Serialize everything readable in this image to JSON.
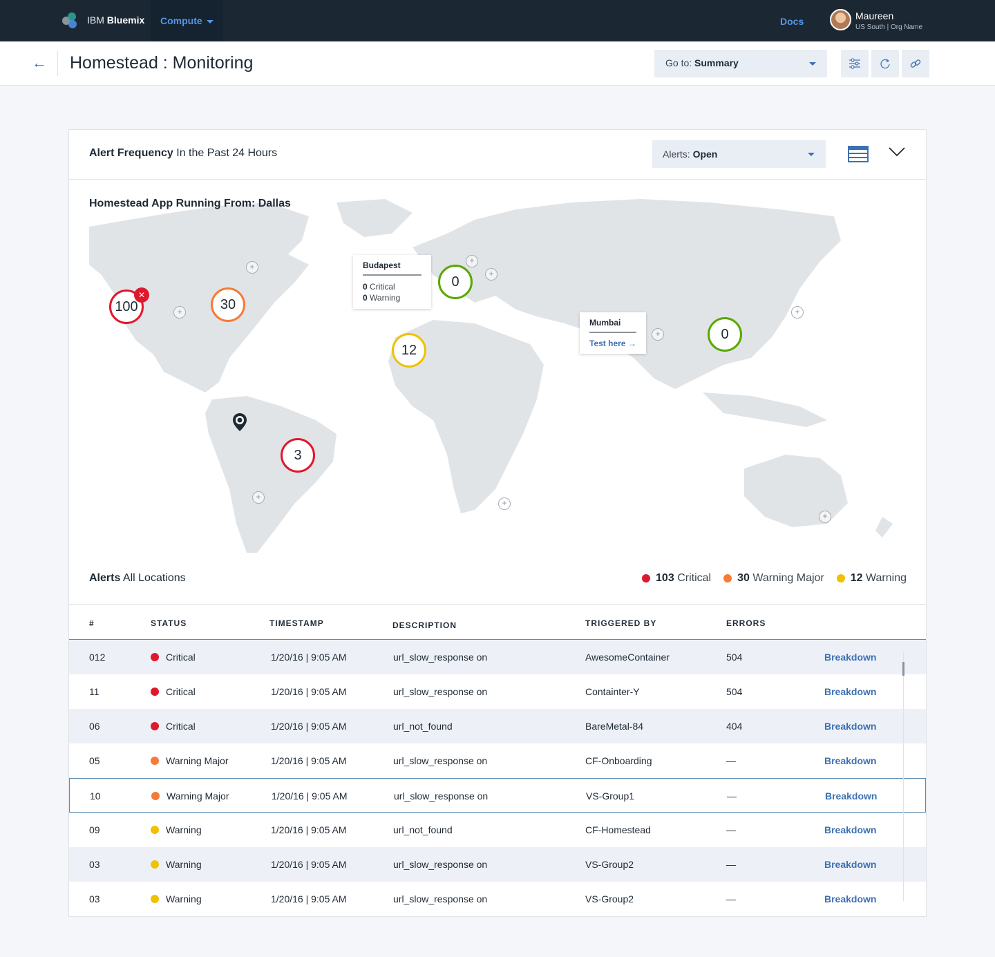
{
  "topnav": {
    "brand_prefix": "IBM",
    "brand_name": "Bluemix",
    "compute_label": "Compute",
    "docs_label": "Docs",
    "user_name": "Maureen",
    "user_org": "US South | Org Name"
  },
  "subheader": {
    "title": "Homestead : Monitoring",
    "goto_prefix": "Go to:",
    "goto_value": "Summary"
  },
  "card": {
    "title_bold": "Alert Frequency",
    "title_rest": "In the Past 24 Hours",
    "alerts_prefix": "Alerts:",
    "alerts_value": "Open",
    "map_title": "Homestead App Running From: Dallas"
  },
  "map": {
    "bubbles": [
      {
        "value": "100",
        "status": "critical",
        "has_close": true
      },
      {
        "value": "30",
        "status": "warning-major"
      },
      {
        "value": "0",
        "status": "ok"
      },
      {
        "value": "12",
        "status": "warning"
      },
      {
        "value": "0",
        "status": "ok"
      },
      {
        "value": "3",
        "status": "critical"
      }
    ],
    "tooltip_budapest": {
      "title": "Budapest",
      "critical_count": "0",
      "critical_label": "Critical",
      "warning_count": "0",
      "warning_label": "Warning"
    },
    "tooltip_mumbai": {
      "title": "Mumbai",
      "link": "Test here"
    }
  },
  "alerts": {
    "title_bold": "Alerts",
    "title_rest": "All Locations",
    "legend": [
      {
        "count": "103",
        "label": "Critical",
        "color": "#e0182d"
      },
      {
        "count": "30",
        "label": "Warning Major",
        "color": "#f57b36"
      },
      {
        "count": "12",
        "label": "Warning",
        "color": "#efc100"
      }
    ]
  },
  "colors": {
    "critical": "#e0182d",
    "warning_major": "#f57b36",
    "warning": "#efc100",
    "ok": "#5aa700",
    "accent": "#3d70b2"
  },
  "table": {
    "headers": [
      "#",
      "STATUS",
      "TIMESTAMP",
      "DESCRIPTION",
      "TRIGGERED BY",
      "ERRORS"
    ],
    "rows": [
      {
        "id": "012",
        "status": "Critical",
        "timestamp": "1/20/16 | 9:05 AM",
        "description": "url_slow_response on",
        "triggered_by": "AwesomeContainer",
        "errors": "504",
        "action": "Breakdown"
      },
      {
        "id": "11",
        "status": "Critical",
        "timestamp": "1/20/16 | 9:05 AM",
        "description": "url_slow_response on",
        "triggered_by": "Containter-Y",
        "errors": "504",
        "action": "Breakdown"
      },
      {
        "id": "06",
        "status": "Critical",
        "timestamp": "1/20/16 | 9:05 AM",
        "description": "url_not_found",
        "triggered_by": "BareMetal-84",
        "errors": "404",
        "action": "Breakdown"
      },
      {
        "id": "05",
        "status": "Warning Major",
        "timestamp": "1/20/16 | 9:05 AM",
        "description": "url_slow_response on",
        "triggered_by": "CF-Onboarding",
        "errors": "—",
        "action": "Breakdown"
      },
      {
        "id": "10",
        "status": "Warning Major",
        "timestamp": "1/20/16 | 9:05 AM",
        "description": "url_slow_response on",
        "triggered_by": "VS-Group1",
        "errors": "—",
        "action": "Breakdown"
      },
      {
        "id": "09",
        "status": "Warning",
        "timestamp": "1/20/16 | 9:05 AM",
        "description": "url_not_found",
        "triggered_by": "CF-Homestead",
        "errors": "—",
        "action": "Breakdown"
      },
      {
        "id": "03",
        "status": "Warning",
        "timestamp": "1/20/16 | 9:05 AM",
        "description": "url_slow_response on",
        "triggered_by": "VS-Group2",
        "errors": "—",
        "action": "Breakdown"
      },
      {
        "id": "03",
        "status": "Warning",
        "timestamp": "1/20/16 | 9:05 AM",
        "description": "url_slow_response on",
        "triggered_by": "VS-Group2",
        "errors": "—",
        "action": "Breakdown"
      }
    ]
  }
}
